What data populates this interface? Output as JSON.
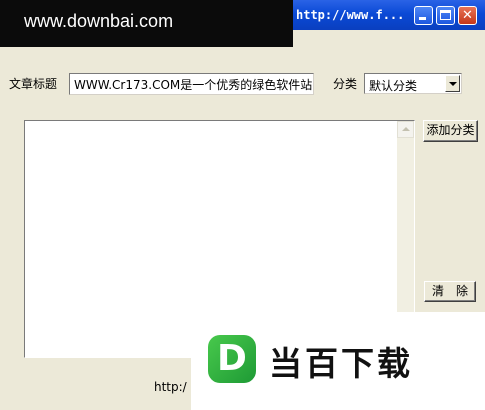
{
  "window": {
    "title": "http://www.f...",
    "watermark": "www.downbai.com",
    "min_icon": "minimize-icon",
    "max_icon": "maximize-icon",
    "close_icon": "close-icon",
    "close_glyph": "✕"
  },
  "form": {
    "title_label": "文章标题",
    "title_value": "WWW.Cr173.COM是一个优秀的绿色软件站",
    "category_label": "分类",
    "category_value": "默认分类",
    "add_category_button": "添加分类",
    "clear_button": "清　除",
    "content_value": ""
  },
  "footer": {
    "url_prefix": "http:/"
  },
  "overlay_logo": {
    "glyph": "D",
    "text": "当百下载",
    "color": "#2fb14a"
  }
}
